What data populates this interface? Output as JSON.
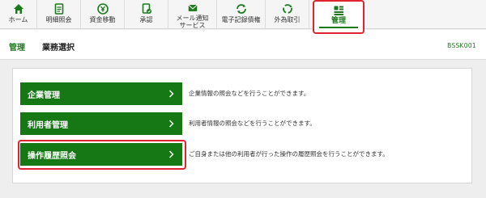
{
  "nav": {
    "tabs": [
      {
        "label": "ホーム",
        "icon": "home-icon"
      },
      {
        "label": "明細照会",
        "icon": "document-icon"
      },
      {
        "label": "資金移動",
        "icon": "yen-transfer-icon"
      },
      {
        "label": "承認",
        "icon": "approval-icon"
      },
      {
        "label": "メール通知\nサービス",
        "icon": "mail-icon"
      },
      {
        "label": "電子記録債権",
        "icon": "cycle-icon"
      },
      {
        "label": "外為取引",
        "icon": "recycle-icon"
      },
      {
        "label": "管理",
        "icon": "management-icon"
      }
    ],
    "accent": "#1b7a1b",
    "highlight": "#e0242f"
  },
  "header": {
    "breadcrumb_main": "管理",
    "breadcrumb_sub": "業務選択",
    "screen_id": "BSSK001"
  },
  "menu": [
    {
      "label": "企業管理",
      "desc": "企業情報の照会などを行うことができます。"
    },
    {
      "label": "利用者管理",
      "desc": "利用者情報の照会などを行うことができます。"
    },
    {
      "label": "操作履歴照会",
      "desc": "ご自身または他の利用者が行った操作の履歴照会を行うことができます。"
    }
  ]
}
